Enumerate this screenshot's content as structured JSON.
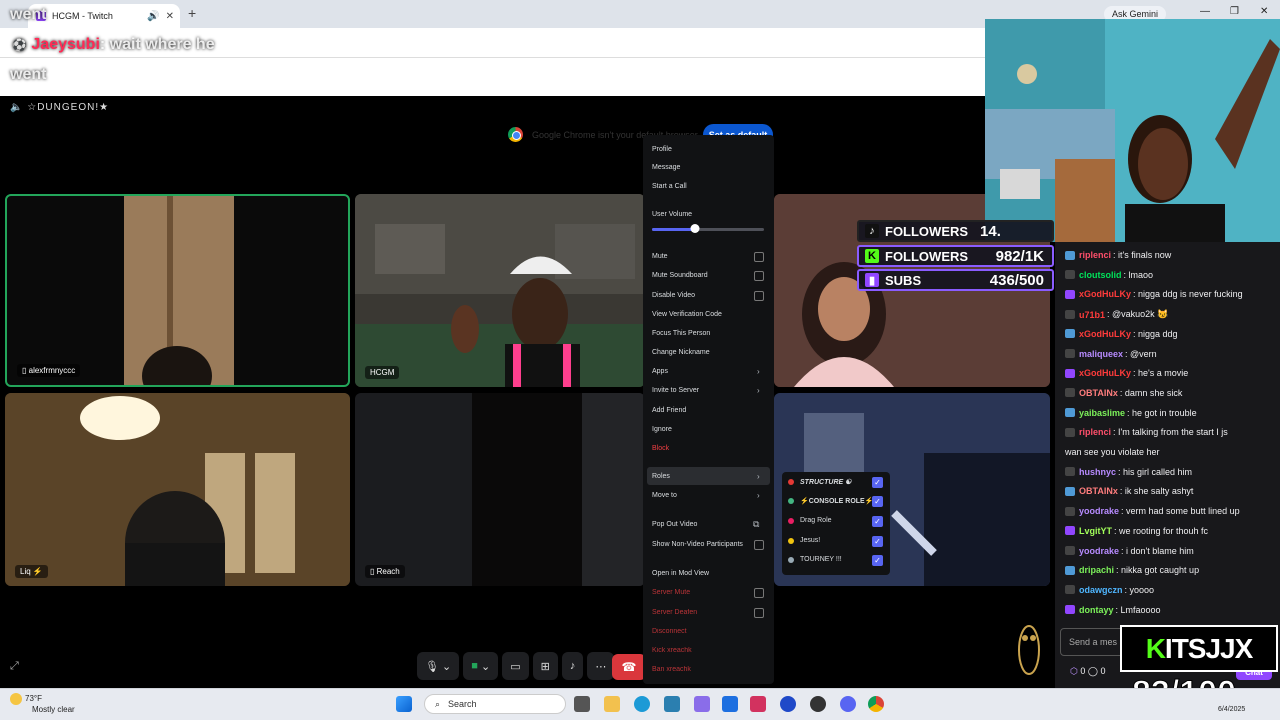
{
  "browser": {
    "tab_title": "HCGM - Twitch",
    "ask_gemini": "Ask Gemini",
    "default_notice": "Google Chrome isn't your default browser",
    "set_default": "Set as default"
  },
  "caption": {
    "line1": "went",
    "name": "Jaeysubi",
    "message": ": wait where he",
    "line3": "went"
  },
  "discord": {
    "server_name": "☆DUNGEON!★",
    "tiles": [
      {
        "label": "alexfrmnyccc"
      },
      {
        "label": "HCGM"
      },
      {
        "label": ""
      },
      {
        "label": "Liq"
      },
      {
        "label": "Reach"
      },
      {
        "label": ""
      }
    ],
    "context_menu": {
      "profile": "Profile",
      "message": "Message",
      "start_call": "Start a Call",
      "user_volume": "User Volume",
      "user_volume_level": 0.38,
      "mute": "Mute",
      "mute_soundboard": "Mute Soundboard",
      "disable_video": "Disable Video",
      "view_verification": "View Verification Code",
      "focus_person": "Focus This Person",
      "change_nickname": "Change Nickname",
      "apps": "Apps",
      "invite_server": "Invite to Server",
      "add_friend": "Add Friend",
      "ignore": "Ignore",
      "block": "Block",
      "roles": "Roles",
      "move_to": "Move to",
      "pop_out": "Pop Out Video",
      "show_non_video": "Show Non-Video Participants",
      "open_mod_view": "Open in Mod View",
      "server_mute": "Server Mute",
      "server_deafen": "Server Deafen",
      "disconnect": "Disconnect",
      "kick": "Kick xreachk",
      "ban": "Ban xreachk"
    },
    "roles": [
      {
        "name": "STRUCTURE ☯",
        "color": "#e53935"
      },
      {
        "name": "⚡CONSOLE ROLE⚡",
        "color": "#43b581"
      },
      {
        "name": "Drag Role",
        "color": "#e91e63"
      },
      {
        "name": "Jesus!",
        "color": "#f1c40f"
      },
      {
        "name": "TOURNEY !!!",
        "color": "#99aab5"
      }
    ]
  },
  "stats": {
    "tiktok": {
      "label": "FOLLOWERS",
      "value": "14."
    },
    "kick": {
      "label": "FOLLOWERS",
      "value": "982/1K"
    },
    "twitch": {
      "label": "SUBS",
      "value": "436/500"
    }
  },
  "chat": {
    "messages": [
      {
        "user": "riplenci",
        "color": "#ff4f6b",
        "text": ": it's finals now"
      },
      {
        "user": "cloutsolid",
        "color": "#00e25a",
        "text": ": lmaoo"
      },
      {
        "user": "xGodHuLKy",
        "color": "#ff3b3b",
        "text": ": nigga ddg is never fucking"
      },
      {
        "user": "u71b1",
        "color": "#ff3b3b",
        "text": ": @vakuo2k 😼"
      },
      {
        "user": "xGodHuLKy",
        "color": "#ff3b3b",
        "text": ": nigga ddg"
      },
      {
        "user": "maliqueex",
        "color": "#b78bff",
        "text": ": @vern"
      },
      {
        "user": "xGodHuLKy",
        "color": "#ff3b3b",
        "text": ": he's a movie"
      },
      {
        "user": "OBTAINx",
        "color": "#ff7d7d",
        "text": ": damn she sick"
      },
      {
        "user": "yaibaslime",
        "color": "#7cf15a",
        "text": ": he got in trouble"
      },
      {
        "user": "riplenci",
        "color": "#ff4f6b",
        "text": ": I'm talking from the start I js"
      },
      {
        "user": "",
        "color": "#efeff1",
        "text": "wan see you violate her"
      },
      {
        "user": "hushnyc",
        "color": "#b78bff",
        "text": ": his girl called him"
      },
      {
        "user": "OBTAINx",
        "color": "#ff7d7d",
        "text": ": ik she salty ashyt"
      },
      {
        "user": "yoodrake",
        "color": "#b78bff",
        "text": ": verm had some butt lined up"
      },
      {
        "user": "LvgitYT",
        "color": "#a2ff5a",
        "text": ": we rooting for thouh fc"
      },
      {
        "user": "yoodrake",
        "color": "#b78bff",
        "text": ": i don't blame him"
      },
      {
        "user": "dripachi",
        "color": "#7cf15a",
        "text": ": nikka got caught up"
      },
      {
        "user": "odawgczn",
        "color": "#4fb6ff",
        "text": ": yoooo"
      },
      {
        "user": "dontayy",
        "color": "#7cf15a",
        "text": ": Lmfaoooo"
      }
    ],
    "input_placeholder": "Send a mes",
    "points": "0",
    "chat_button": "Chat"
  },
  "kick_logo": "ITSJJX",
  "sub_goal": "83/100",
  "taskbar": {
    "temperature": "73°F",
    "weather": "Mostly clear",
    "search": "Search",
    "date": "6/4/2025"
  }
}
